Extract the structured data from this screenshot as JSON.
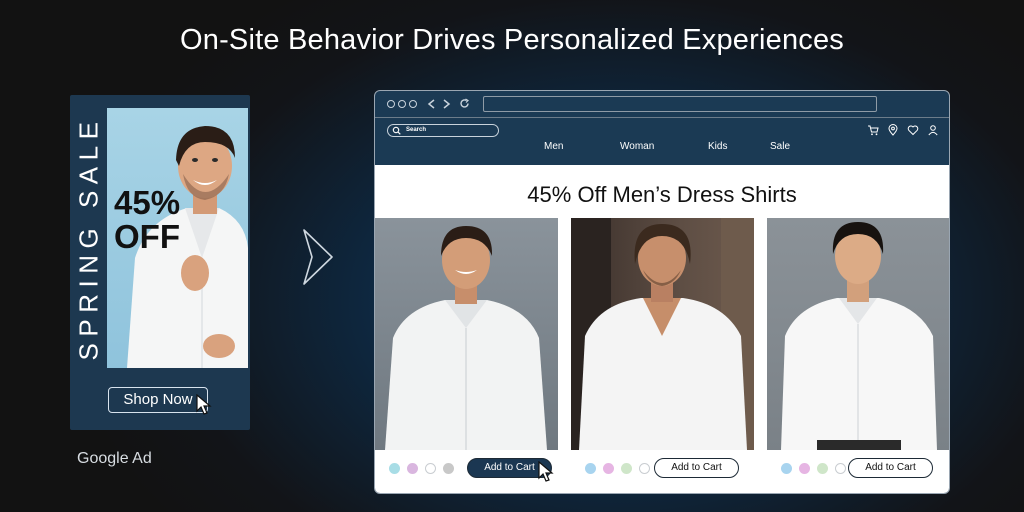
{
  "headline": "On-Site Behavior Drives Personalized Experiences",
  "ad": {
    "vertical_text": "SPRING SALE",
    "offer_line1": "45%",
    "offer_line2": "OFF",
    "button_label": "Shop Now",
    "caption": "Google Ad"
  },
  "browser": {
    "search_placeholder": "Search",
    "nav": [
      "Men",
      "Woman",
      "Kids",
      "Sale"
    ],
    "icons": [
      "cart-icon",
      "location-icon",
      "heart-icon",
      "user-icon"
    ],
    "banner_title": "45% Off Men’s Dress Shirts",
    "products": [
      {
        "cart_label": "Add to Cart",
        "active": true,
        "swatches": [
          "#a8dde6",
          "#d9b6df",
          "#ffffff",
          "#c8c8c8"
        ]
      },
      {
        "cart_label": "Add to Cart",
        "active": false,
        "swatches": [
          "#a8d4ef",
          "#e6b5e3",
          "#cfe6c9",
          "#ffffff"
        ]
      },
      {
        "cart_label": "Add to Cart",
        "active": false,
        "swatches": [
          "#a8d4ef",
          "#e6b5e3",
          "#cfe6c9",
          "#ffffff"
        ]
      }
    ]
  },
  "colors": {
    "navy": "#1d3850",
    "accent_button": "#1b3752",
    "ad_photo_bg": "#a8d4e6"
  }
}
